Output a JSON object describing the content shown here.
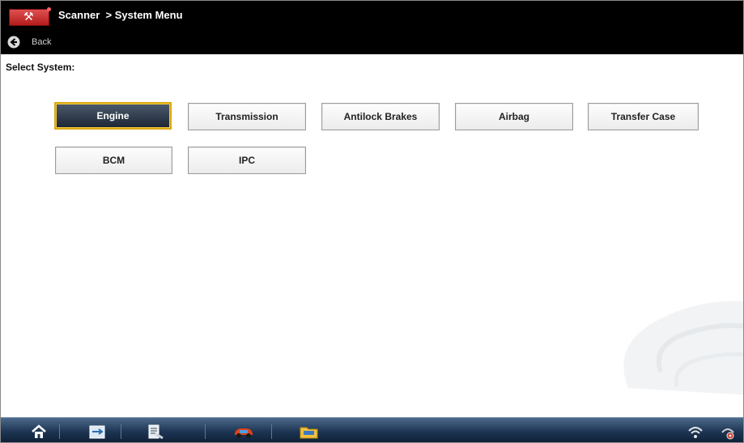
{
  "titlebar": {
    "title": "Scanner  > System Menu",
    "back_label": "Back"
  },
  "content": {
    "prompt": "Select System:",
    "systems": [
      {
        "label": "Engine",
        "selected": true
      },
      {
        "label": "Transmission"
      },
      {
        "label": "Antilock Brakes"
      },
      {
        "label": "Airbag"
      },
      {
        "label": "Transfer Case"
      },
      {
        "label": "BCM"
      },
      {
        "label": "IPC"
      }
    ]
  },
  "colors": {
    "titlebar_bg": "#000000",
    "selection_border": "#d9a914",
    "selected_button_bg": "#2a3545",
    "taskbar_bg": "#1d3553"
  },
  "icons": {
    "app": "scanner-tool-icon",
    "back": "back-arrow-icon",
    "taskbar": [
      "home-icon",
      "data-manager-icon",
      "scanner-icon",
      "vehicle-icon",
      "folder-icon",
      "wifi-icon",
      "settings-icon"
    ]
  }
}
